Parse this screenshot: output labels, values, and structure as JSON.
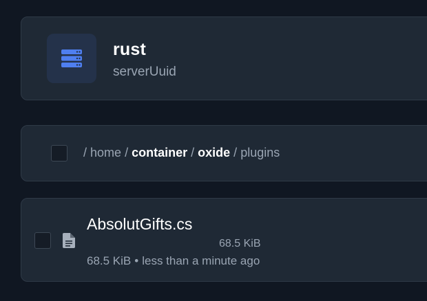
{
  "server": {
    "name": "rust",
    "uuid": "serverUuid",
    "icon": "server-rack-icon",
    "icon_color": "#4f7ff0",
    "icon_tile_color": "#24324a"
  },
  "breadcrumb": {
    "segments": [
      {
        "label": "home",
        "emphasis": false
      },
      {
        "label": "container",
        "emphasis": true
      },
      {
        "label": "oxide",
        "emphasis": true
      },
      {
        "label": "plugins",
        "emphasis": false
      }
    ],
    "separator": "/"
  },
  "files": [
    {
      "name": "AbsolutGifts.cs",
      "size": "68.5 KiB",
      "size_secondary": "68.5 KiB",
      "modified": "less than a minute ago",
      "meta_separator": "•",
      "icon": "file-document-icon"
    }
  ],
  "colors": {
    "background": "#101722",
    "card": "#1f2935",
    "text_primary": "#ffffff",
    "text_secondary": "#9aa5b3"
  }
}
